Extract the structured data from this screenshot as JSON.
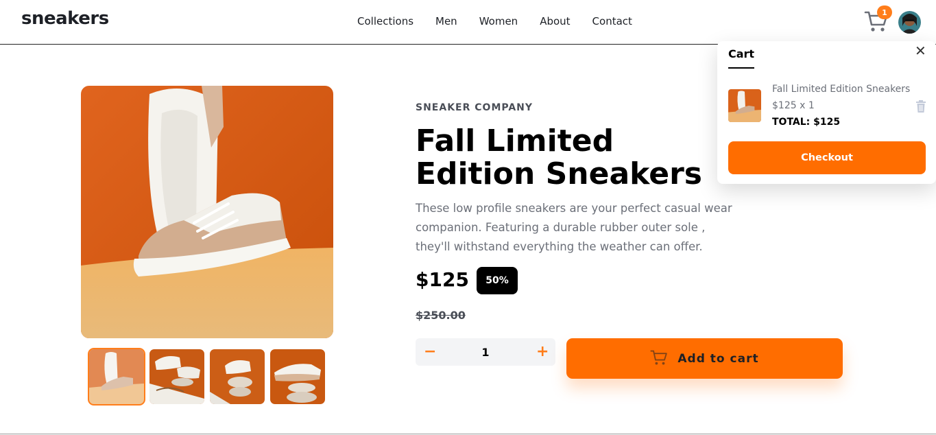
{
  "header": {
    "logo": "sneakers",
    "nav": [
      "Collections",
      "Men",
      "Women",
      "About",
      "Contact"
    ],
    "cart_count": "1",
    "cart_icon": "cart-icon",
    "avatar_icon": "avatar-image"
  },
  "product": {
    "company": "SNEAKER COMPANY",
    "title": "Fall Limited Edition Sneakers",
    "description": "These low profile sneakers are your perfect casual wear companion. Featuring a durable rubber outer sole , they'll withstand everything the weather can offer.",
    "price": "$125",
    "discount": "50%",
    "old_price": "$250.00",
    "quantity": "1",
    "minus": "−",
    "plus": "+",
    "add_to_cart": "Add to cart",
    "thumbnail_count": 4,
    "selected_thumbnail": 1
  },
  "cart": {
    "title": "Cart",
    "close": "✕",
    "item_name": "Fall Limited Edition Sneakers",
    "item_price_qty": "$125 x 1",
    "total": "TOTAL: $125",
    "checkout": "Checkout"
  },
  "colors": {
    "accent": "#ff6d00",
    "badge": "#ff7d1a",
    "text_dark": "#1d2026",
    "text_muted": "#6b6f78"
  }
}
